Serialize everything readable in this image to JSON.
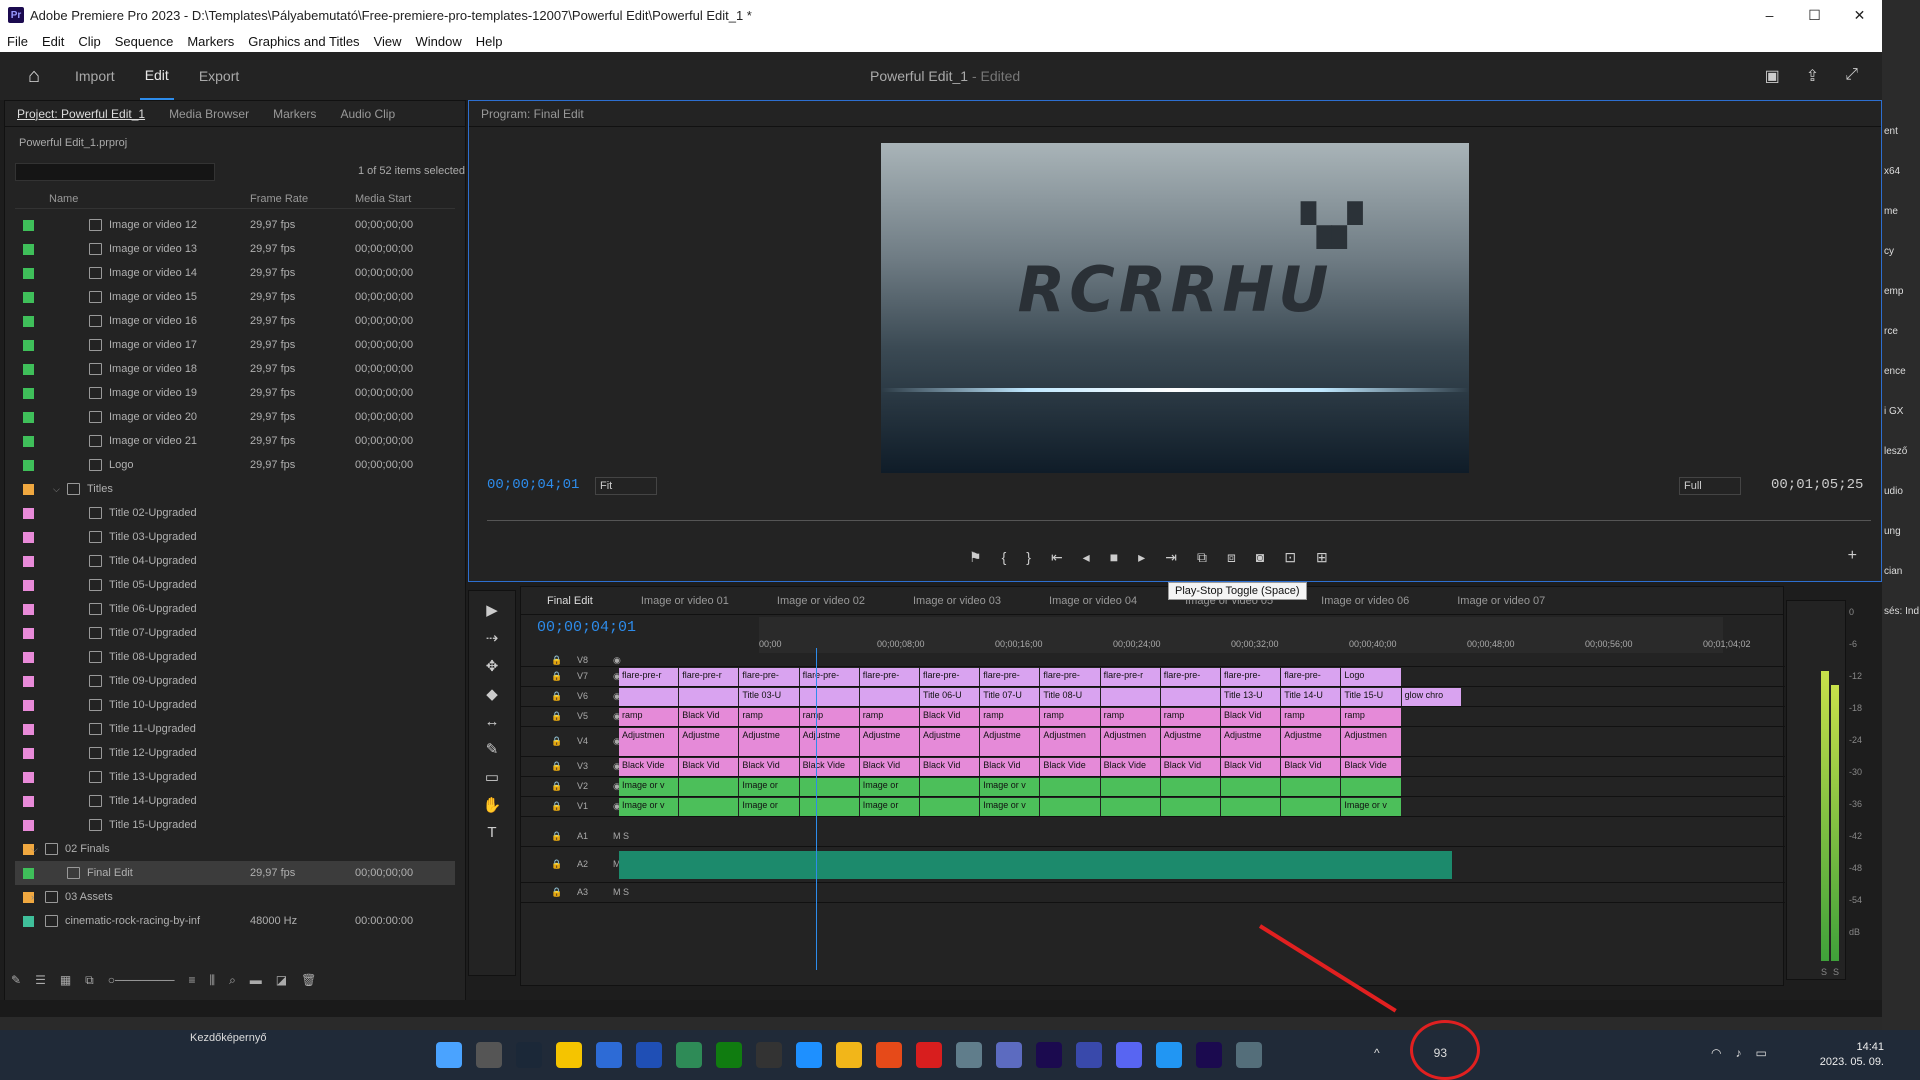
{
  "window": {
    "title": "Adobe Premiere Pro 2023 - D:\\Templates\\Pályabemutató\\Free-premiere-pro-templates-12007\\Powerful Edit\\Powerful Edit_1 *",
    "app_icon": "Pr",
    "controls": [
      "–",
      "☐",
      "✕"
    ]
  },
  "menu": [
    "File",
    "Edit",
    "Clip",
    "Sequence",
    "Markers",
    "Graphics and Titles",
    "View",
    "Window",
    "Help"
  ],
  "workspace": {
    "tabs": [
      "Import",
      "Edit",
      "Export"
    ],
    "active_tab": "Edit",
    "project_title": "Powerful Edit_1",
    "edited_label": "- Edited"
  },
  "project_panel": {
    "tabs": [
      "Project: Powerful Edit_1",
      "Media Browser",
      "Markers",
      "Audio Clip"
    ],
    "path": "Powerful Edit_1.prproj",
    "selection_count": "1 of 52 items selected",
    "columns": [
      "Name",
      "Frame Rate",
      "Media Start"
    ],
    "rows": [
      {
        "name": "Image or video 12",
        "rate": "29,97 fps",
        "start": "00;00;00;00",
        "color": "#3fbf5a",
        "indent": 2
      },
      {
        "name": "Image or video 13",
        "rate": "29,97 fps",
        "start": "00;00;00;00",
        "color": "#3fbf5a",
        "indent": 2
      },
      {
        "name": "Image or video 14",
        "rate": "29,97 fps",
        "start": "00;00;00;00",
        "color": "#3fbf5a",
        "indent": 2
      },
      {
        "name": "Image or video 15",
        "rate": "29,97 fps",
        "start": "00;00;00;00",
        "color": "#3fbf5a",
        "indent": 2
      },
      {
        "name": "Image or video 16",
        "rate": "29,97 fps",
        "start": "00;00;00;00",
        "color": "#3fbf5a",
        "indent": 2
      },
      {
        "name": "Image or video 17",
        "rate": "29,97 fps",
        "start": "00;00;00;00",
        "color": "#3fbf5a",
        "indent": 2
      },
      {
        "name": "Image or video 18",
        "rate": "29,97 fps",
        "start": "00;00;00;00",
        "color": "#3fbf5a",
        "indent": 2
      },
      {
        "name": "Image or video 19",
        "rate": "29,97 fps",
        "start": "00;00;00;00",
        "color": "#3fbf5a",
        "indent": 2
      },
      {
        "name": "Image or video 20",
        "rate": "29,97 fps",
        "start": "00;00;00;00",
        "color": "#3fbf5a",
        "indent": 2
      },
      {
        "name": "Image or video 21",
        "rate": "29,97 fps",
        "start": "00;00;00;00",
        "color": "#3fbf5a",
        "indent": 2
      },
      {
        "name": "Logo",
        "rate": "29,97 fps",
        "start": "00;00;00;00",
        "color": "#3fbf5a",
        "indent": 2
      },
      {
        "name": "Titles",
        "rate": "",
        "start": "",
        "color": "#f0a840",
        "indent": 1,
        "folder": true,
        "twirl": "⌵"
      },
      {
        "name": "Title 02-Upgraded",
        "rate": "",
        "start": "",
        "color": "#e88ad8",
        "indent": 2
      },
      {
        "name": "Title 03-Upgraded",
        "rate": "",
        "start": "",
        "color": "#e88ad8",
        "indent": 2
      },
      {
        "name": "Title 04-Upgraded",
        "rate": "",
        "start": "",
        "color": "#e88ad8",
        "indent": 2
      },
      {
        "name": "Title 05-Upgraded",
        "rate": "",
        "start": "",
        "color": "#e88ad8",
        "indent": 2
      },
      {
        "name": "Title 06-Upgraded",
        "rate": "",
        "start": "",
        "color": "#e88ad8",
        "indent": 2
      },
      {
        "name": "Title 07-Upgraded",
        "rate": "",
        "start": "",
        "color": "#e88ad8",
        "indent": 2
      },
      {
        "name": "Title 08-Upgraded",
        "rate": "",
        "start": "",
        "color": "#e88ad8",
        "indent": 2
      },
      {
        "name": "Title 09-Upgraded",
        "rate": "",
        "start": "",
        "color": "#e88ad8",
        "indent": 2
      },
      {
        "name": "Title 10-Upgraded",
        "rate": "",
        "start": "",
        "color": "#e88ad8",
        "indent": 2
      },
      {
        "name": "Title 11-Upgraded",
        "rate": "",
        "start": "",
        "color": "#e88ad8",
        "indent": 2
      },
      {
        "name": "Title 12-Upgraded",
        "rate": "",
        "start": "",
        "color": "#e88ad8",
        "indent": 2
      },
      {
        "name": "Title 13-Upgraded",
        "rate": "",
        "start": "",
        "color": "#e88ad8",
        "indent": 2
      },
      {
        "name": "Title 14-Upgraded",
        "rate": "",
        "start": "",
        "color": "#e88ad8",
        "indent": 2
      },
      {
        "name": "Title 15-Upgraded",
        "rate": "",
        "start": "",
        "color": "#e88ad8",
        "indent": 2
      },
      {
        "name": "02 Finals",
        "rate": "",
        "start": "",
        "color": "#f0a840",
        "indent": 0,
        "folder": true,
        "twirl": "⌵"
      },
      {
        "name": "Final Edit",
        "rate": "29,97 fps",
        "start": "00;00;00;00",
        "color": "#3fbf5a",
        "indent": 1,
        "selected": true
      },
      {
        "name": "03 Assets",
        "rate": "",
        "start": "",
        "color": "#f0a840",
        "indent": 0,
        "folder": true,
        "twirl": "›"
      },
      {
        "name": "cinematic-rock-racing-by-inf",
        "rate": "48000 Hz",
        "start": "00:00:00:00",
        "color": "#3fbf9a",
        "indent": 0
      }
    ]
  },
  "program_monitor": {
    "title": "Program: Final Edit",
    "overlay_text": "RCRRHU",
    "timecode_in": "00;00;04;01",
    "zoom": "Fit",
    "quality": "Full",
    "duration": "00;01;05;25",
    "transport": [
      "marker-icon",
      "in-icon",
      "out-icon",
      "go-in-icon",
      "step-back-icon",
      "stop-icon",
      "step-forward-icon",
      "go-out-icon",
      "insert-icon",
      "overwrite-icon",
      "camera-icon",
      "export-frame-icon",
      "compare-icon"
    ],
    "transport_glyphs": [
      "⚑",
      "{",
      "}",
      "⇤",
      "◂",
      "■",
      "▸",
      "⇥",
      "⧉",
      "⧈",
      "◙",
      "⊡",
      "⊞"
    ],
    "tooltip": "Play-Stop Toggle (Space)",
    "add_glyph": "+"
  },
  "tools": [
    "▶",
    "⇢",
    "✥",
    "◆",
    "↔",
    "✎",
    "▭",
    "✋",
    "T"
  ],
  "timeline": {
    "tabs": [
      "Final Edit",
      "Image or video 01",
      "Image or video 02",
      "Image or video 03",
      "Image or video 04",
      "Image or video 05",
      "Image or video 06",
      "Image or video 07"
    ],
    "timecode": "00;00;04;01",
    "ruler": [
      "00;00",
      "00;00;08;00",
      "00;00;16;00",
      "00;00;24;00",
      "00;00;32;00",
      "00;00;40;00",
      "00;00;48;00",
      "00;00;56;00",
      "00;01;04;02"
    ],
    "tracks": [
      {
        "label": "V8",
        "type": "v"
      },
      {
        "label": "V7",
        "type": "v"
      },
      {
        "label": "V6",
        "type": "v"
      },
      {
        "label": "V5",
        "type": "v"
      },
      {
        "label": "V4",
        "type": "v"
      },
      {
        "label": "V3",
        "type": "v"
      },
      {
        "label": "V2",
        "type": "v"
      },
      {
        "label": "V1",
        "type": "v"
      },
      {
        "label": "A1",
        "type": "a"
      },
      {
        "label": "A2",
        "type": "a"
      },
      {
        "label": "A3",
        "type": "a"
      }
    ],
    "clip_rows": {
      "V7": [
        "flare-pre-r",
        "flare-pre-r",
        "flare-pre-",
        "flare-pre-",
        "flare-pre-",
        "flare-pre-",
        "flare-pre-",
        "flare-pre-",
        "flare-pre-r",
        "flare-pre-",
        "flare-pre-",
        "flare-pre-",
        "Logo"
      ],
      "V6": [
        "",
        "",
        "Title 03-U",
        "",
        "",
        "Title 06-U",
        "Title 07-U",
        "Title 08-U",
        "",
        "",
        "Title 13-U",
        "Title 14-U",
        "Title 15-U",
        "glow chro"
      ],
      "V5": [
        "ramp",
        "Black Vid",
        "ramp",
        "ramp",
        "ramp",
        "Black Vid",
        "ramp",
        "ramp",
        "ramp",
        "ramp",
        "Black Vid",
        "ramp",
        "ramp"
      ],
      "V4": [
        "Adjustmen",
        "Adjustme",
        "Adjustme",
        "Adjustme",
        "Adjustme",
        "Adjustme",
        "Adjustme",
        "Adjustmen",
        "Adjustmen",
        "Adjustme",
        "Adjustme",
        "Adjustme",
        "Adjustmen"
      ],
      "V3": [
        "Black Vide",
        "Black Vid",
        "Black Vid",
        "Black Vide",
        "Black Vid",
        "Black Vid",
        "Black Vid",
        "Black Vide",
        "Black Vide",
        "Black Vid",
        "Black Vid",
        "Black Vid",
        "Black Vide"
      ],
      "V2": [
        "Image or v",
        "",
        "Image or",
        "",
        "Image or",
        "",
        "Image or v",
        "",
        "",
        "",
        "",
        "",
        ""
      ],
      "V1": [
        "Image or v",
        "",
        "Image or",
        "",
        "Image or",
        "",
        "Image or v",
        "",
        "",
        "",
        "",
        "",
        "Image or v"
      ]
    }
  },
  "meters": {
    "db": [
      "0",
      "-6",
      "-12",
      "-18",
      "-24",
      "-30",
      "-36",
      "-42",
      "-48",
      "-54",
      "dB"
    ],
    "solo": [
      "S",
      "S"
    ]
  },
  "desktop_right": [
    "ent",
    "x64",
    "me",
    "cy",
    "emp",
    "rce",
    "ence",
    "i GX",
    "lesző",
    "udio",
    "ung",
    "cian",
    "sés: Ind"
  ],
  "taskbar": {
    "home_label": "Kezdőképernyő",
    "badge": "93",
    "time": "14:41",
    "date": "2023. 05. 09.",
    "icon_colors": [
      "#4aa3ff",
      "#555",
      "#1b2838",
      "#f5c400",
      "#2d6bd6",
      "#1f4fb5",
      "#2e8b57",
      "#107c10",
      "#333",
      "#1e90ff",
      "#f2b619",
      "#e64a19",
      "#d81e1e",
      "#607d8b",
      "#5c6bc0",
      "#1b0a4f",
      "#3949ab",
      "#5865f2",
      "#2196f3",
      "#1b0a4f",
      "#546e7a"
    ]
  }
}
